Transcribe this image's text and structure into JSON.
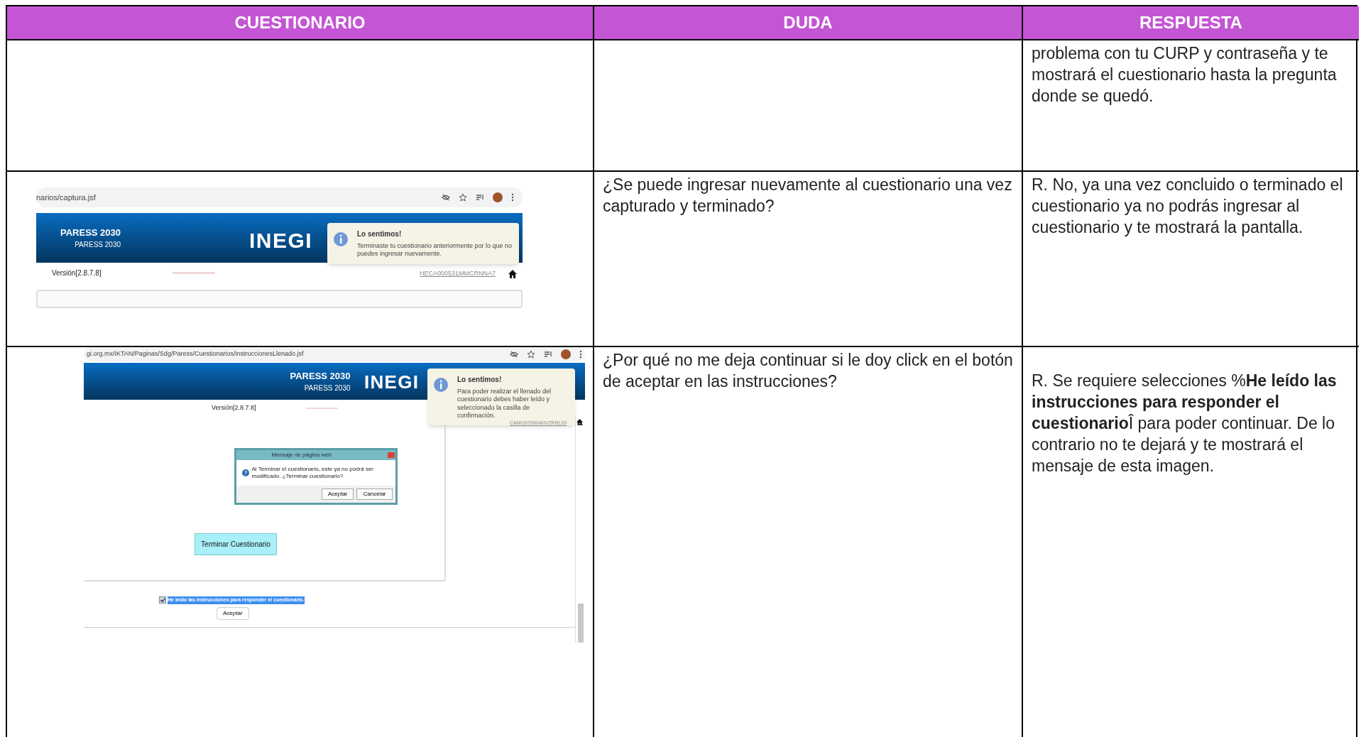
{
  "table": {
    "columns": [
      "CUESTIONARIO",
      "DUDA",
      "RESPUESTA"
    ],
    "rows": [
      {
        "respuesta": "problema con tu CURP y contraseña y te mostrará el cuestionario hasta la pregunta donde se quedó."
      },
      {
        "screenshot": {
          "url": "narios/captura.jsf",
          "title": "PARESS 2030",
          "subtitle": "PARESS 2030",
          "logo": "INEGI",
          "version": "Versión[2.8.7.8]",
          "notice": {
            "title": "Lo sentimos!",
            "message": "Terminaste tu cuestionario anteriormente por lo que no puedes ingresar nuevamente."
          },
          "user_code": "HECA000531MMCRNNA7"
        },
        "duda": "¿Se puede ingresar nuevamente al cuestionario una vez capturado y terminado?",
        "respuesta": "R. No, ya una vez concluido o terminado el cuestionario ya no podrás ingresar al cuestionario y te mostrará la pantalla."
      },
      {
        "screenshot": {
          "url": "gi.org.mx/IKTAN/Paginas/Sdg/Paress/Cuestionarios/instruccionesLlenado.jsf",
          "title": "PARESS 2030",
          "subtitle": "PARESS 2030",
          "logo": "INEGI",
          "version": "Versión[2.8.7.8]",
          "notice": {
            "title": "Lo sentimos!",
            "message": "Para poder realizar el llenado del cuestionario debes haber leído y seleccionado la casilla de confirmación."
          },
          "user_code": "CAMG970904HVZRRL09",
          "dialog": {
            "title": "Mensaje de página web",
            "message": "Al Terminar el cuestionario, este ya no podrá ser modificado. ¿Terminar cuestionario?",
            "buttons": [
              "Aceptar",
              "Cancelar"
            ]
          },
          "finish_button": "Terminar Cuestionario",
          "checkbox": {
            "label": "He leído las instrucciones para responder el cuestionario.",
            "checked": true
          },
          "accept_button": "Aceptar"
        },
        "duda": "¿Por qué no me deja continuar si le doy click en el botón de aceptar en las instrucciones?",
        "respuesta": "R. Se requiere selecciones %**He leído las instrucciones para responder el cuestionario**Î para poder continuar. De lo contrario no te dejará y te mostrará el mensaje de esta imagen."
      }
    ]
  }
}
